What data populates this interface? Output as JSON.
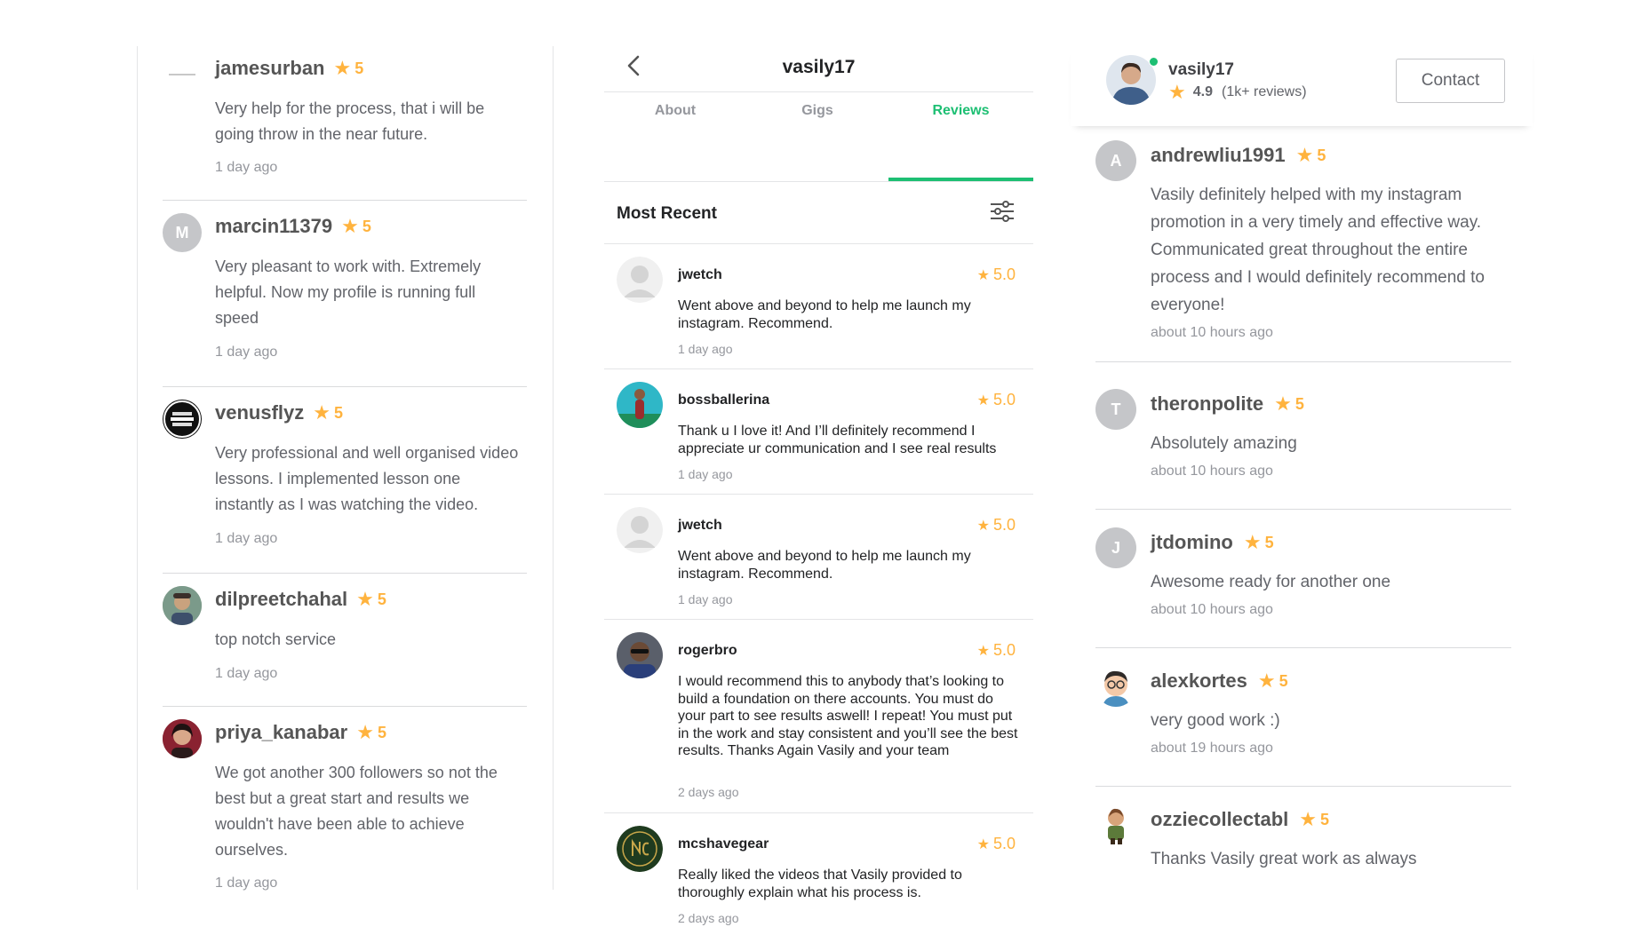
{
  "left_panel": {
    "reviews": [
      {
        "username": "jamesurban",
        "rating": "5",
        "text": "Very help for the process, that i will be going throw in the near future.",
        "time": "1 day ago",
        "avatar_icon": "tiny-logo-icon"
      },
      {
        "username": "marcin11379",
        "rating": "5",
        "text": "Very pleasant to work with. Extremely helpful. Now my profile is running full speed",
        "time": "1 day ago",
        "avatar_letter": "M"
      },
      {
        "username": "venusflyz",
        "rating": "5",
        "text": "Very professional and well organised video lessons. I implemented lesson one instantly as I was watching the video.",
        "time": "1 day ago",
        "avatar_icon": "music-logo-icon"
      },
      {
        "username": "dilpreetchahal",
        "rating": "5",
        "text": "top notch service",
        "time": "1 day ago",
        "avatar_icon": "person-photo-icon"
      },
      {
        "username": "priya_kanabar",
        "rating": "5",
        "text": "We got another 300 followers so not the best but a great start and results we wouldn't have been able to achieve ourselves.",
        "time": "1 day ago",
        "avatar_icon": "person-photo-icon"
      }
    ]
  },
  "middle_panel": {
    "title": "vasily17",
    "tabs": [
      "About",
      "Gigs",
      "Reviews"
    ],
    "active_tab": "Reviews",
    "sort_label": "Most Recent",
    "reviews": [
      {
        "username": "jwetch",
        "rating": "5.0",
        "text": "Went above and beyond to help me launch my instagram.  Recommend.",
        "time": "1 day ago"
      },
      {
        "username": "bossballerina",
        "rating": "5.0",
        "text": "Thank u I love it! And I’ll definitely recommend I appreciate ur communication and I see real results",
        "time": "1 day ago"
      },
      {
        "username": "jwetch",
        "rating": "5.0",
        "text": "Went above and beyond to help me launch my instagram.  Recommend.",
        "time": "1 day ago"
      },
      {
        "username": "rogerbro",
        "rating": "5.0",
        "text": "I would recommend this to anybody that’s looking to build a foundation on there accounts. You must do your part to see results aswell! I repeat! You must put in the work and stay consistent and you’ll see the best results. Thanks Again Vasily and your team",
        "time": "2 days ago"
      },
      {
        "username": "mcshavegear",
        "rating": "5.0",
        "text": "Really liked the videos that Vasily provided to thoroughly explain what his process is.",
        "time": "2 days ago"
      }
    ]
  },
  "right_panel": {
    "seller": {
      "username": "vasily17",
      "score": "4.9",
      "review_count": "(1k+ reviews)",
      "online": true
    },
    "contact_label": "Contact",
    "reviews": [
      {
        "username": "andrewliu1991",
        "rating": "5",
        "text": "Vasily definitely helped with my instagram promotion in a very timely and effective way. Communicated great throughout the entire process and I would definitely recommend to everyone!",
        "time": "about 10 hours ago",
        "avatar_letter": "A"
      },
      {
        "username": "theronpolite",
        "rating": "5",
        "text": "Absolutely amazing",
        "time": "about 10 hours ago",
        "avatar_letter": "T"
      },
      {
        "username": "jtdomino",
        "rating": "5",
        "text": "Awesome ready for another one",
        "time": "about 10 hours ago",
        "avatar_letter": "J"
      },
      {
        "username": "alexkortes",
        "rating": "5",
        "text": "very good work :)",
        "time": "about 19 hours ago"
      },
      {
        "username": "ozziecollectabl",
        "rating": "5",
        "text": "Thanks Vasily great work as always",
        "time": ""
      }
    ]
  },
  "colors": {
    "accent_green": "#1dbf73",
    "star_gold": "#ffb33e",
    "text_gray": "#62646a",
    "time_gray": "#95979d"
  },
  "icons": {
    "star": "★",
    "back": "chevron-left-icon",
    "filter": "sliders-icon"
  }
}
